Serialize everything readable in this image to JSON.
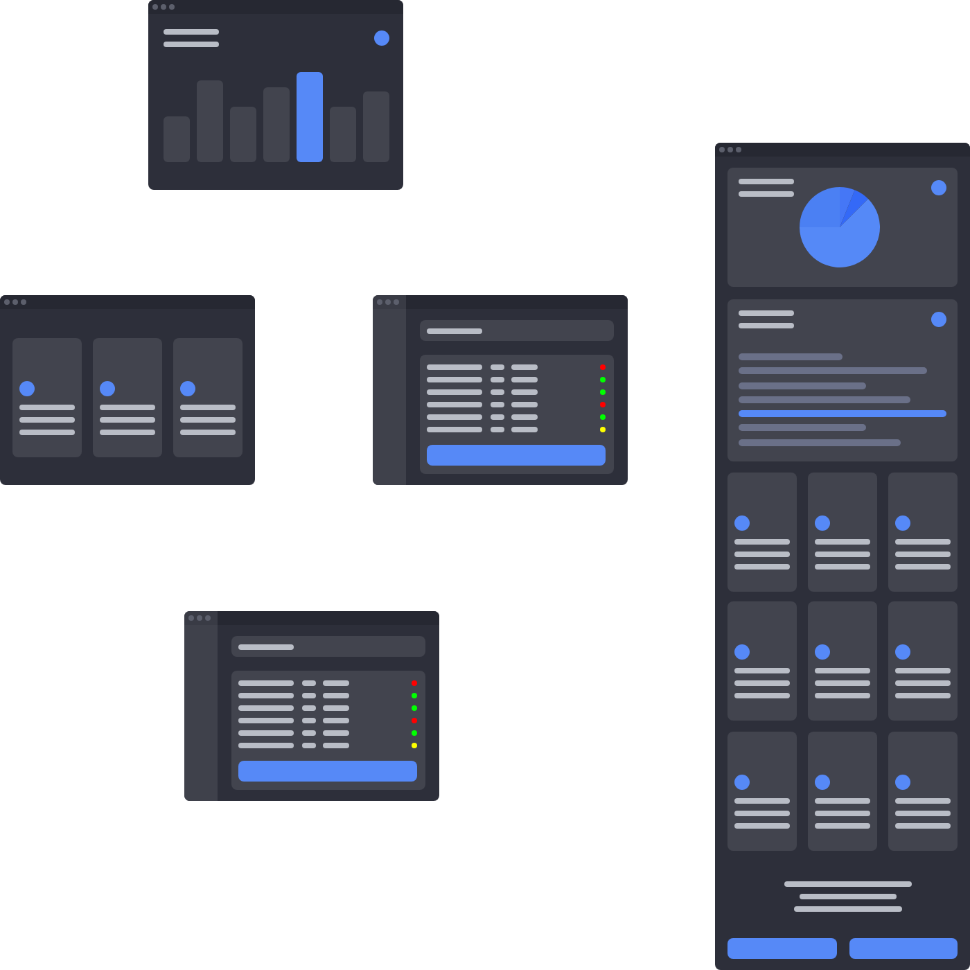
{
  "windows": [
    {
      "kind": "chart",
      "bars": [
        {
          "selected": false
        },
        {
          "selected": false
        },
        {
          "selected": false
        },
        {
          "selected": false
        },
        {
          "selected": true
        },
        {
          "selected": false
        },
        {
          "selected": false
        }
      ]
    },
    {
      "kind": "cards",
      "cards": [
        {
          "kind": "icon-card"
        },
        {
          "kind": "icon-card"
        },
        {
          "kind": "icon-card"
        }
      ]
    },
    {
      "kind": "table",
      "rows": [
        {
          "color": "#ff0000"
        },
        {
          "color": "#00ff00"
        },
        {
          "color": "#00ff00"
        },
        {
          "color": "#ff0000"
        },
        {
          "color": "#00ff00"
        },
        {
          "color": "#ffff00"
        }
      ]
    },
    {
      "kind": "table",
      "rows": [
        {
          "color": "#ff0000"
        },
        {
          "color": "#00ff00"
        },
        {
          "color": "#00ff00"
        },
        {
          "color": "#ff0000"
        },
        {
          "color": "#00ff00"
        },
        {
          "color": "#ffff00"
        }
      ]
    },
    {
      "kind": "dashboard",
      "panels": [
        {
          "kind": "pie"
        },
        {
          "kind": "list",
          "items": [
            {
              "selected": false
            },
            {
              "selected": false
            },
            {
              "selected": false
            },
            {
              "selected": false
            },
            {
              "selected": true
            },
            {
              "selected": false
            },
            {
              "selected": false
            }
          ]
        }
      ],
      "cards": [
        {
          "kind": "icon-card"
        },
        {
          "kind": "icon-card"
        },
        {
          "kind": "icon-card"
        },
        {
          "kind": "icon-card"
        },
        {
          "kind": "icon-card"
        },
        {
          "kind": "icon-card"
        },
        {
          "kind": "icon-card"
        },
        {
          "kind": "icon-card"
        },
        {
          "kind": "icon-card"
        }
      ],
      "buttons": [
        {
          "kind": "primary"
        },
        {
          "kind": "primary"
        }
      ]
    }
  ]
}
